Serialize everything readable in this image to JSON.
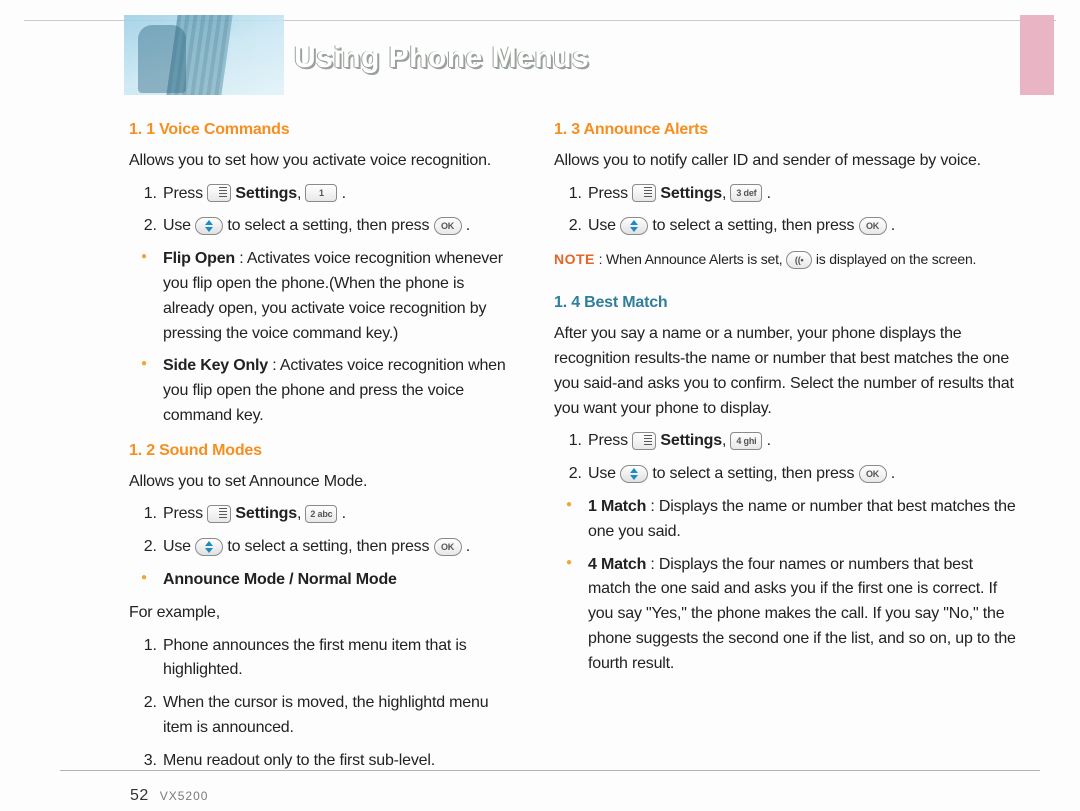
{
  "header": {
    "title": "Using Phone Menus"
  },
  "left": {
    "s1": {
      "heading": "1. 1 Voice Commands",
      "intro": "Allows you to set how you activate voice recognition.",
      "step1_a": "Press",
      "step1_b": "Settings",
      "step2_a": "Use",
      "step2_b": "to select a setting, then press",
      "bul1_label": "Flip Open",
      "bul1_text": " : Activates voice recognition whenever you flip open the phone.(When the phone is already open, you activate voice recognition by pressing the voice command key.)",
      "bul2_label": "Side Key Only",
      "bul2_text": " : Activates voice recognition when you flip open the phone and press the voice command key."
    },
    "s2": {
      "heading": "1. 2 Sound Modes",
      "intro": "Allows you to set Announce Mode.",
      "step1_a": "Press",
      "step1_b": "Settings",
      "step2_a": "Use",
      "step2_b": "to select a setting, then press",
      "mode_label": "Announce Mode / Normal Mode",
      "example_intro": "For example,",
      "ex1": "Phone announces the first menu item that is highlighted.",
      "ex2": "When the cursor is moved, the highlightd menu item is announced.",
      "ex3": "Menu readout only to the first sub-level."
    }
  },
  "right": {
    "s3": {
      "heading": "1. 3 Announce Alerts",
      "intro": "Allows you to notify caller ID and sender of message by voice.",
      "step1_a": "Press",
      "step1_b": "Settings",
      "step2_a": "Use",
      "step2_b": "to select a setting, then press",
      "note_label": "NOTE",
      "note_text_a": " :  When Announce Alerts is set,",
      "note_text_b": "is displayed on the screen."
    },
    "s4": {
      "heading": "1. 4 Best Match",
      "intro": "After you say a name or a number, your phone displays the recognition results-the name or number that best matches the one you said-and asks you to confirm. Select the number of results that you want your phone to display.",
      "step1_a": "Press",
      "step1_b": "Settings",
      "step2_a": "Use",
      "step2_b": "to select a setting, then press",
      "bul1_label": "1 Match",
      "bul1_text": " : Displays the name or number that best matches the one you said.",
      "bul2_label": "4 Match",
      "bul2_text": " : Displays the four names or numbers that best match the one said and asks you if the first one is correct. If you say \"Yes,\" the phone makes the call. If you say \"No,\" the phone suggests the second one if the list, and so on, up to the fourth result."
    }
  },
  "keys": {
    "one": "1",
    "two": "2 abc",
    "three": "3 def",
    "four": "4 ghi",
    "ok": "OK"
  },
  "footer": {
    "page": "52",
    "model": "VX5200"
  }
}
